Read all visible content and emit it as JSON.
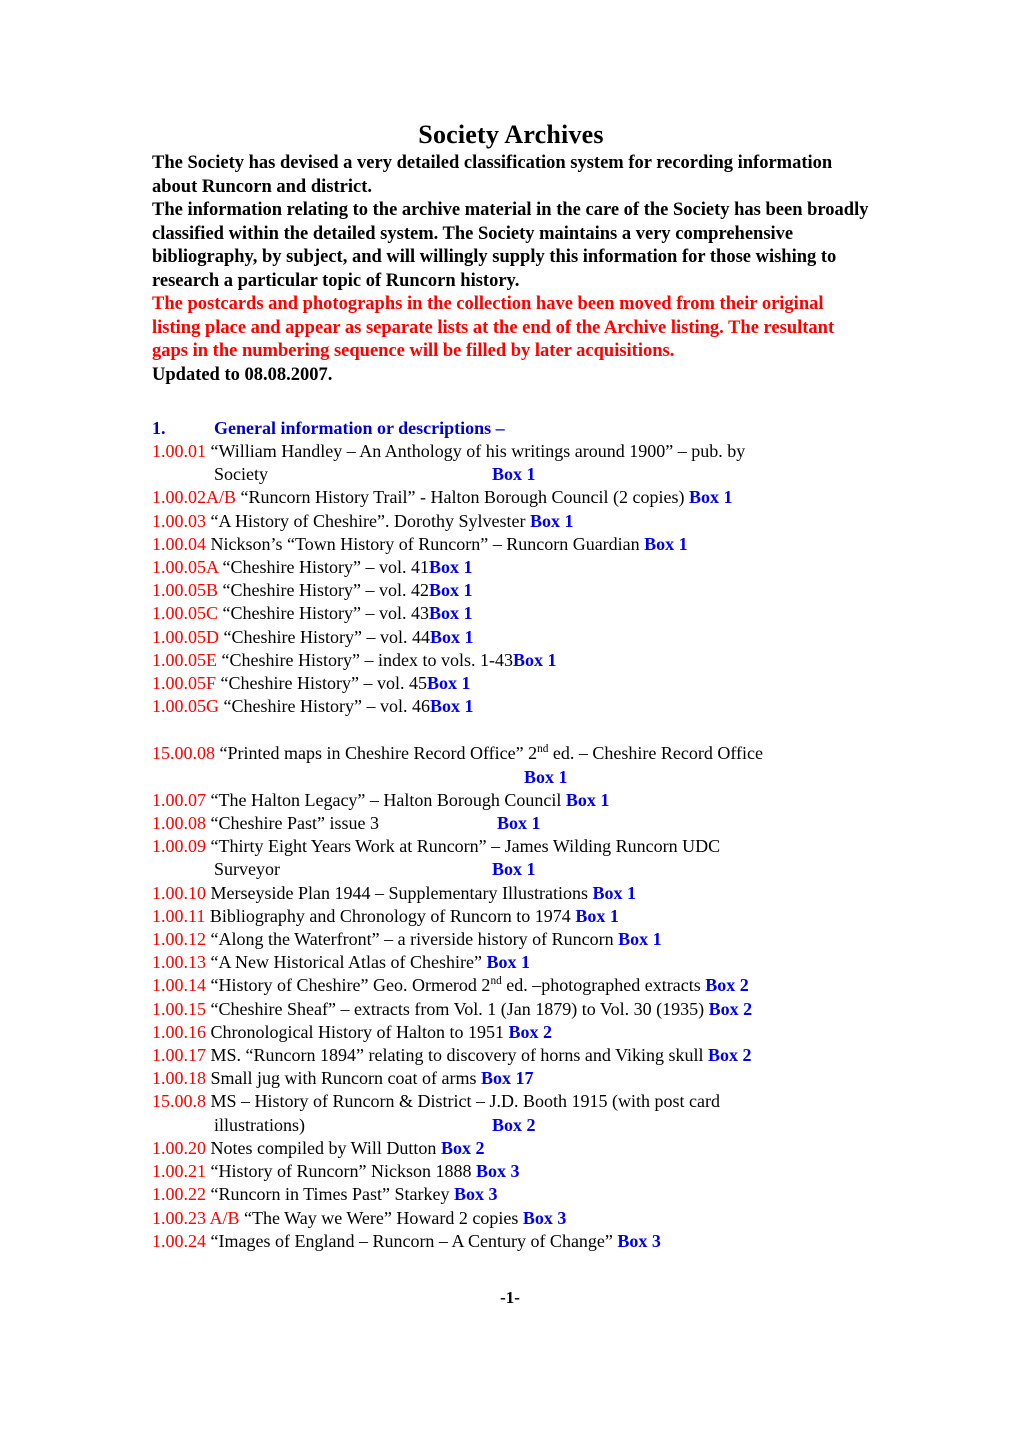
{
  "document": {
    "title": "Society Archives",
    "intro_paragraphs": [
      {
        "color": "black",
        "text": "The Society has devised a very detailed classification system for recording information about Runcorn and district."
      },
      {
        "color": "black",
        "text": "The information relating to the archive material in the care of the Society has been broadly classified within the detailed system. The Society maintains a very comprehensive bibliography, by subject, and will willingly supply this information for those wishing to research a particular topic of Runcorn history."
      },
      {
        "color": "red",
        "text": "The postcards and photographs in the collection have been moved from their original listing place and appear as separate lists at the end of the Archive listing. The resultant gaps in the numbering sequence will be filled by later acquisitions."
      },
      {
        "color": "black",
        "text": "Updated to 08.08.2007."
      }
    ],
    "section": {
      "number": "1.",
      "heading": "General information or descriptions –"
    },
    "colors": {
      "index_red": "#FF0000",
      "box_blue": "#0000EE",
      "heading_blue": "#0000CC",
      "body_black": "#000000",
      "page_background": "#FFFFFF"
    },
    "footer": "-1-"
  },
  "entries": [
    {
      "index": "1.00.01",
      "text": "“William Handley – An Anthology of his writings around 1900” – pub. by",
      "continuation": "Society",
      "box": "Box 1",
      "box_on_continuation": true
    },
    {
      "index": "1.00.02A/B",
      "text": "“Runcorn History Trail” - Halton Borough Council (2 copies)",
      "box": "Box 1"
    },
    {
      "index": "1.00.03",
      "text": "“A History of Cheshire”. Dorothy Sylvester",
      "box": "Box 1"
    },
    {
      "index": "1.00.04",
      "text": "Nickson’s “Town History of Runcorn” – Runcorn Guardian",
      "box": "Box 1"
    },
    {
      "index": "1.00.05A",
      "text": "“Cheshire History” – vol. 41",
      "box": "Box 1",
      "no_space_before_box": true
    },
    {
      "index": "1.00.05B",
      "text": "“Cheshire History” – vol. 42",
      "box": "Box 1",
      "no_space_before_box": true
    },
    {
      "index": "1.00.05C",
      "text": "“Cheshire History” – vol. 43",
      "box": "Box 1",
      "no_space_before_box": true
    },
    {
      "index": "1.00.05D",
      "text": "“Cheshire History” – vol. 44",
      "box": "Box 1",
      "no_space_before_box": true
    },
    {
      "index": "1.00.05E",
      "text": "“Cheshire History” – index to vols. 1-43",
      "box": "Box 1",
      "no_space_before_box": true
    },
    {
      "index": "1.00.05F",
      "text": "“Cheshire History” – vol. 45",
      "box": "Box 1",
      "no_space_before_box": true
    },
    {
      "index": "1.00.05G",
      "text": "“Cheshire History” – vol. 46",
      "box": "Box 1",
      "no_space_before_box": true
    },
    {
      "blank": true
    },
    {
      "index": "15.00.08",
      "text_pre": "“Printed maps in Cheshire Record Office” 2",
      "superscript": "nd",
      "text_post": " ed. – Cheshire Record Office",
      "box": "Box 1",
      "box_own_line": true
    },
    {
      "index": "1.00.07",
      "text": "“The Halton Legacy” – Halton Borough Council",
      "box": "Box 1"
    },
    {
      "index": "1.00.08",
      "text": "“Cheshire Past” issue 3",
      "box": "Box 1",
      "tab_before_box": true
    },
    {
      "index": "1.00.09",
      "text": "“Thirty Eight Years Work at Runcorn” – James Wilding Runcorn UDC",
      "continuation": "Surveyor",
      "box": "Box 1",
      "box_on_continuation": true
    },
    {
      "index": "1.00.10",
      "text": "Merseyside Plan 1944 – Supplementary Illustrations",
      "box": "Box 1"
    },
    {
      "index": "1.00.11",
      "text": "Bibliography and Chronology of Runcorn to 1974",
      "box": "Box 1"
    },
    {
      "index": "1.00.12",
      "text": "“Along the Waterfront” – a riverside history of Runcorn",
      "box": "Box 1"
    },
    {
      "index": "1.00.13",
      "text": "“A New Historical Atlas of Cheshire”",
      "box": "Box 1"
    },
    {
      "index": "1.00.14",
      "text_pre": "“History of Cheshire” Geo. Ormerod 2",
      "superscript": "nd",
      "text_post": " ed. –photographed extracts",
      "box": "Box 2"
    },
    {
      "index": "1.00.15",
      "text": "“Cheshire Sheaf” – extracts from Vol. 1 (Jan 1879) to Vol. 30 (1935)",
      "box": "Box 2"
    },
    {
      "index": "1.00.16",
      "text": "Chronological History of Halton to 1951",
      "box": "Box 2"
    },
    {
      "index": "1.00.17",
      "text": "MS. “Runcorn 1894” relating to discovery of horns and Viking skull",
      "box": "Box 2"
    },
    {
      "index": "1.00.18",
      "text": "Small jug with Runcorn coat of arms",
      "box": "Box 17"
    },
    {
      "index": "15.00.8",
      "text": "MS – History of Runcorn & District – J.D. Booth 1915 (with post card",
      "continuation": "illustrations)",
      "box": "Box 2",
      "box_on_continuation": true
    },
    {
      "index": "1.00.20",
      "text": "Notes compiled by Will Dutton",
      "box": "Box 2"
    },
    {
      "index": "1.00.21",
      "text": "“History of Runcorn” Nickson 1888",
      "box": "Box 3"
    },
    {
      "index": "1.00.22",
      "text": "“Runcorn in Times Past” Starkey",
      "box": "Box  3"
    },
    {
      "index": "1.00.23 A/B",
      "text": "“The Way we Were” Howard 2 copies ",
      "box": "Box 3"
    },
    {
      "index": "1.00.24",
      "text": " “Images of England – Runcorn – A Century of Change” ",
      "box": "Box 3"
    }
  ]
}
